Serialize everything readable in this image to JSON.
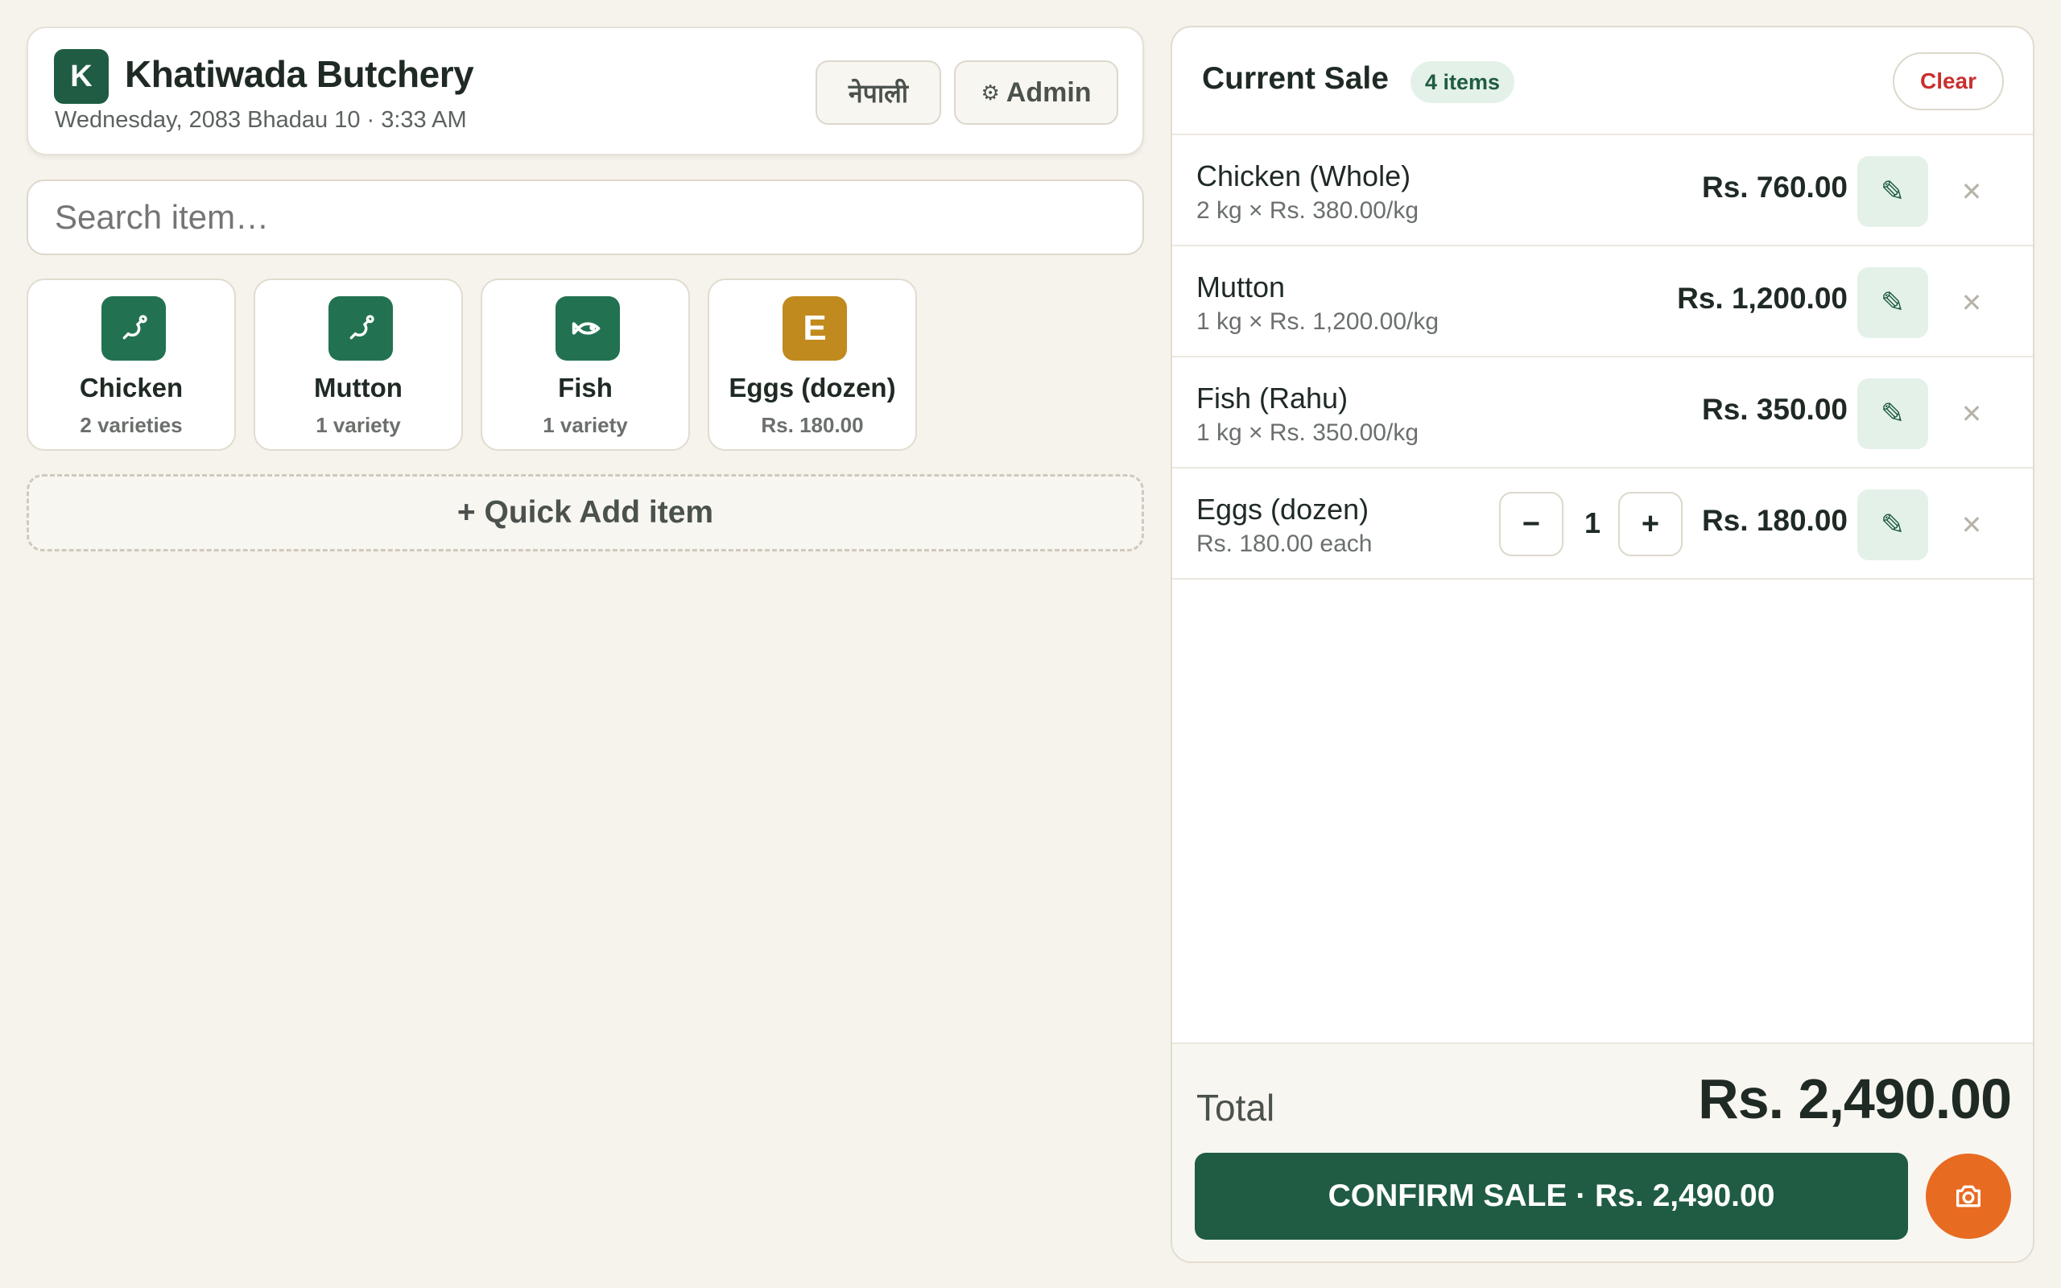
{
  "header": {
    "logo_letter": "K",
    "shop_name": "Khatiwada Butchery",
    "date_time": "Wednesday, 2083 Bhadau 10 · 3:33 AM",
    "language_button": "नेपाली",
    "admin_button": "Admin",
    "admin_icon": "gear-icon"
  },
  "search": {
    "placeholder": "Search item…"
  },
  "categories": [
    {
      "name": "Chicken",
      "sub": "2 varieties",
      "icon": "drumstick-icon"
    },
    {
      "name": "Mutton",
      "sub": "1 variety",
      "icon": "drumstick-icon"
    },
    {
      "name": "Fish",
      "sub": "1 variety",
      "icon": "fish-icon"
    },
    {
      "name": "Eggs (dozen)",
      "sub": "Rs. 180.00",
      "icon_letter": "E"
    }
  ],
  "quick_add_label": "+ Quick Add item",
  "sale": {
    "title": "Current Sale",
    "count_badge": "4 items",
    "clear_label": "Clear",
    "items": [
      {
        "name": "Chicken (Whole)",
        "detail": "2 kg × Rs. 380.00/kg",
        "price": "Rs. 760.00"
      },
      {
        "name": "Mutton",
        "detail": "1 kg × Rs. 1,200.00/kg",
        "price": "Rs. 1,200.00"
      },
      {
        "name": "Fish (Rahu)",
        "detail": "1 kg × Rs. 350.00/kg",
        "price": "Rs. 350.00"
      },
      {
        "name": "Eggs (dozen)",
        "detail": "Rs. 180.00 each",
        "price": "Rs. 180.00",
        "quantity": "1",
        "minus": "−",
        "plus": "+"
      }
    ],
    "total_label": "Total",
    "total_value": "Rs. 2,490.00",
    "confirm_label": "CONFIRM SALE · Rs. 2,490.00",
    "edit_icon": "pencil-icon",
    "remove_icon": "close-icon",
    "camera_icon": "camera-icon"
  },
  "colors": {
    "brand_green": "#1f5c43",
    "accent_orange": "#e86b22",
    "clear_red": "#c92f2f",
    "egg_gold": "#c08a1e"
  }
}
